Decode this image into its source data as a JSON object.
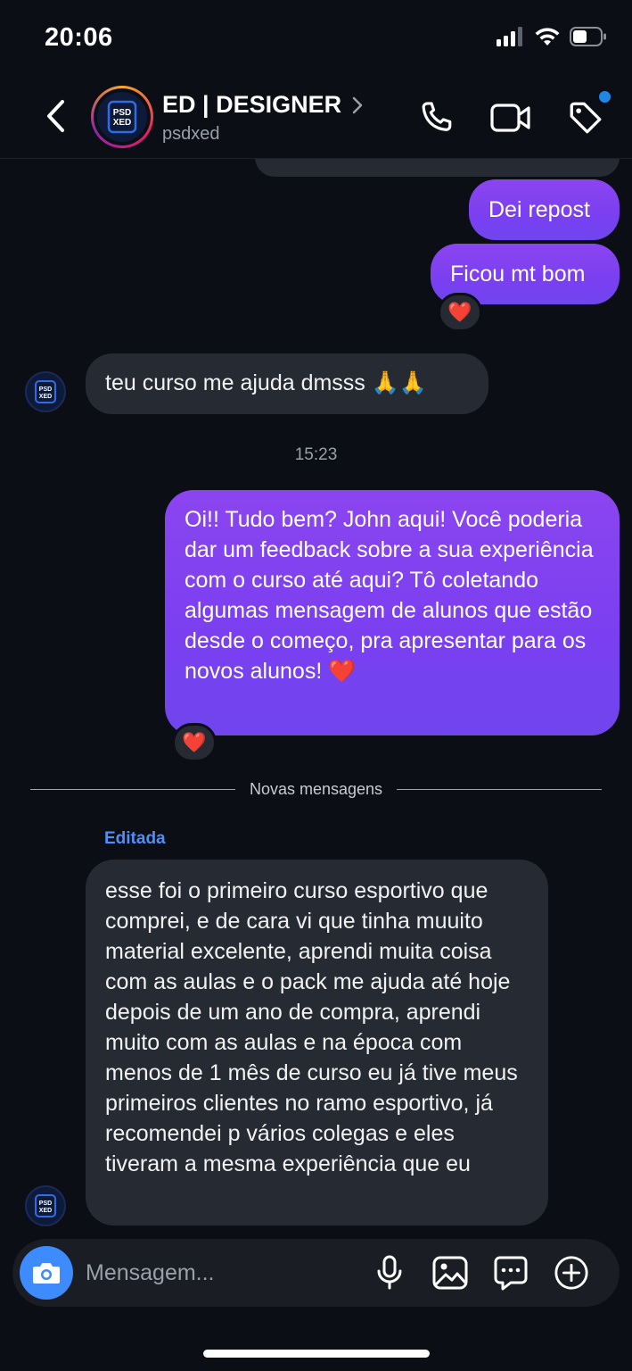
{
  "status_bar": {
    "time": "20:06"
  },
  "header": {
    "name": "ED | DESIGNER",
    "username": "psdxed",
    "avatar_text": "PSD XED",
    "icons": [
      "back-icon",
      "chevron-right-icon",
      "phone-icon",
      "video-icon",
      "tag-icon"
    ]
  },
  "messages": {
    "partial_top": "…",
    "out_1": "Dei repost",
    "out_2": "Ficou mt bom",
    "reaction_1": "❤️",
    "in_1": "teu curso me ajuda dmsss 🙏🙏",
    "timestamp": "15:23",
    "out_3": "Oi!! Tudo bem? John aqui! Você poderia dar um feedback sobre a sua experiência com o curso até aqui? Tô coletando algumas mensagem de alunos que estão desde o começo, pra apresentar para os novos alunos! ❤️",
    "reaction_2": "❤️",
    "divider_label": "Novas mensagens",
    "edited_label": "Editada",
    "in_2": "esse foi o primeiro curso esportivo que comprei, e de cara vi que tinha muuito material excelente, aprendi muita coisa com as aulas e o pack me ajuda até hoje depois de um ano de compra, aprendi muito com as aulas e na época com menos de 1 mês de curso eu já tive meus primeiros clientes no ramo esportivo, já recomendei p vários colegas e eles tiveram a mesma experiência que eu"
  },
  "composer": {
    "placeholder": "Mensagem...",
    "icons": [
      "camera-icon",
      "microphone-icon",
      "image-icon",
      "sticker-icon",
      "plus-circle-icon"
    ]
  },
  "colors": {
    "background": "#0b0e14",
    "outgoing_bubble": "#7a3ff0",
    "incoming_bubble": "#262a33",
    "accent_blue": "#3e8bff"
  }
}
